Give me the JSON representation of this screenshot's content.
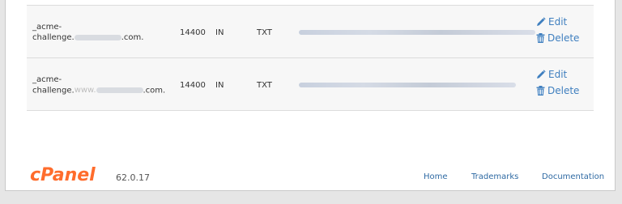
{
  "table": {
    "rows": [
      {
        "name_prefix": "_acme-",
        "name_middle": "challenge.",
        "name_suffix": ".com.",
        "ttl": "14400",
        "class": "IN",
        "type": "TXT",
        "record_value": "",
        "actions": {
          "edit_label": "Edit",
          "delete_label": "Delete"
        }
      },
      {
        "name_prefix": "_acme-",
        "name_middle": "challenge.",
        "name_www": "www.",
        "name_suffix": ".com.",
        "ttl": "14400",
        "class": "IN",
        "type": "TXT",
        "record_value": "",
        "actions": {
          "edit_label": "Edit",
          "delete_label": "Delete"
        }
      }
    ]
  },
  "footer": {
    "logo_text": "cPanel",
    "version": "62.0.17",
    "links": {
      "home": "Home",
      "trademarks": "Trademarks",
      "documentation": "Documentation"
    }
  },
  "colors": {
    "link": "#3f7fbf",
    "logo": "#ff6c2c"
  },
  "icons": {
    "edit": "pencil-icon",
    "delete": "trash-icon"
  }
}
